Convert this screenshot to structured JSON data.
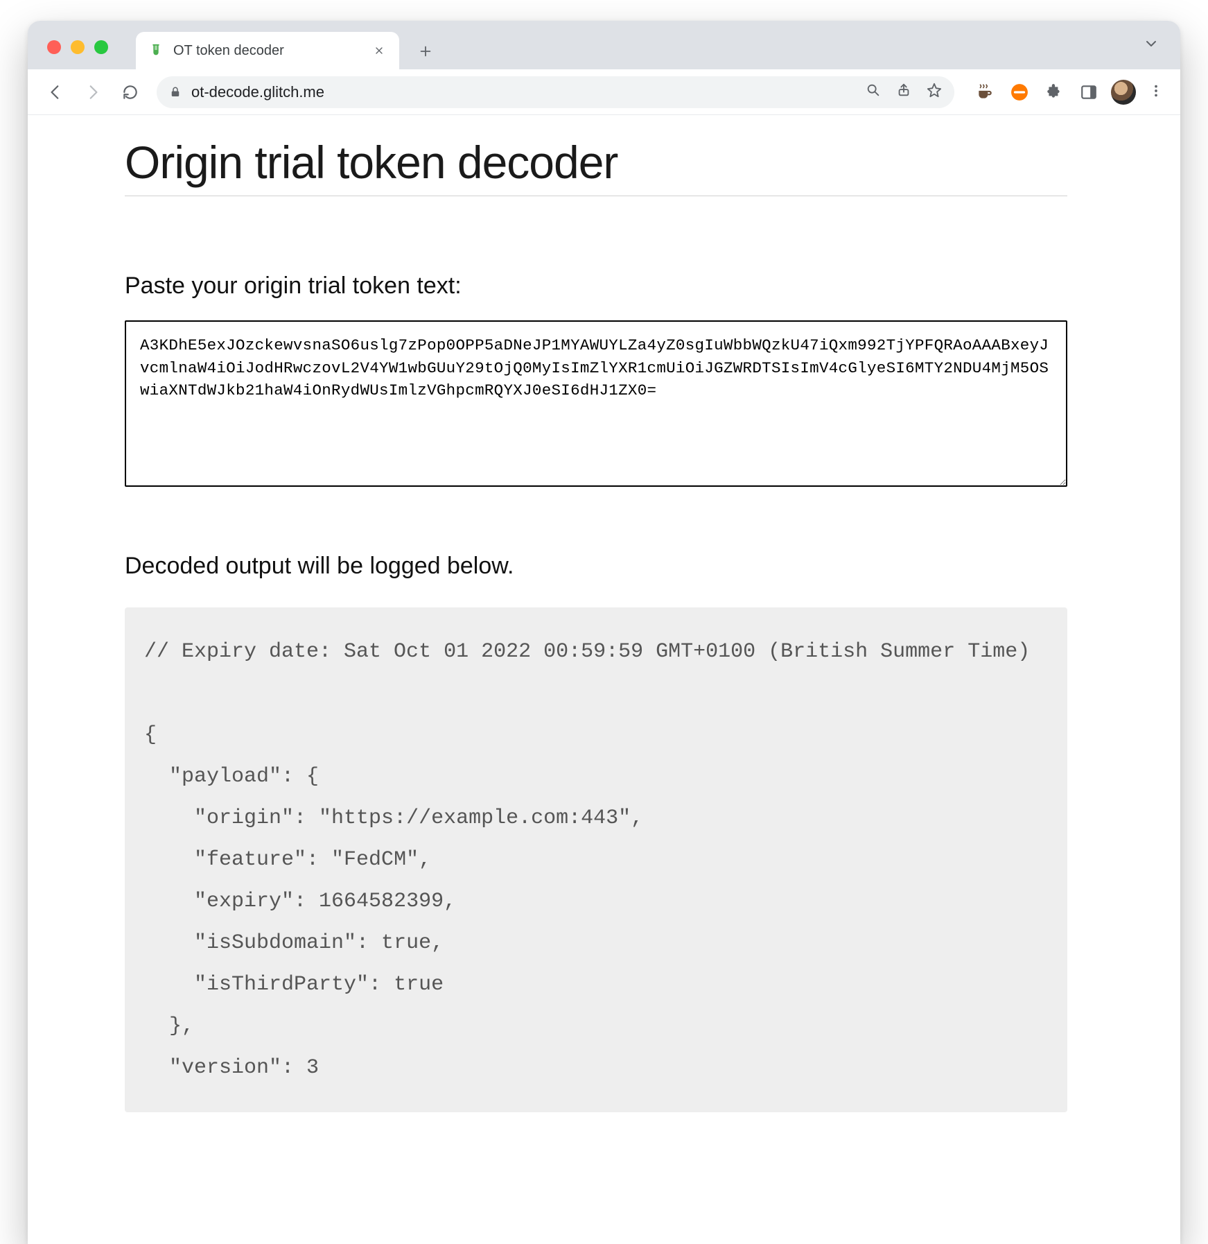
{
  "browser": {
    "tab": {
      "title": "OT token decoder",
      "favicon_name": "test-tube-icon"
    },
    "omnibox": {
      "url": "ot-decode.glitch.me",
      "secure": true
    }
  },
  "page": {
    "title": "Origin trial token decoder",
    "paste_label": "Paste your origin trial token text:",
    "token_value": "A3KDhE5exJOzckewvsnaSO6uslg7zPop0OPP5aDNeJP1MYAWUYLZa4yZ0sgIuWbbWQzkU47iQxm992TjYPFQRAoAAABxeyJvcmlnaW4iOiJodHRwczovL2V4YW1wbGUuY29tOjQ0MyIsImZlYXR1cmUiOiJGZWRDTSIsImV4cGlyeSI6MTY2NDU4MjM5OSwiaXNTdWJkb21haW4iOnRydWUsImlzVGhpcmRQYXJ0eSI6dHJ1ZX0=",
    "output_label": "Decoded output will be logged below.",
    "decoded_output": "// Expiry date: Sat Oct 01 2022 00:59:59 GMT+0100 (British Summer Time)\n\n{\n  \"payload\": {\n    \"origin\": \"https://example.com:443\",\n    \"feature\": \"FedCM\",\n    \"expiry\": 1664582399,\n    \"isSubdomain\": true,\n    \"isThirdParty\": true\n  },\n  \"version\": 3"
  }
}
